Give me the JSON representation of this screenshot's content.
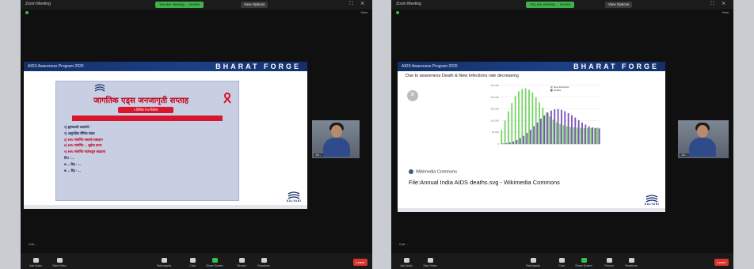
{
  "left": {
    "window_title": "Zoom Meeting",
    "share_banner": "You are viewing ... screen",
    "view_options": "View Options",
    "view_label": "View",
    "slide": {
      "program": "AIDS Awareness Program 2020",
      "brand": "BHARAT FORGE",
      "poster_title": "जागतिक एड्स जनजागृती सप्ताह",
      "poster_date": "१ डिसेंबर ते ७ डिसेंबर",
      "poster_lines": [
        "१) ह्यांच्याशी असलेले :",
        "२) असुरक्षित लैंगिक संबंध",
        "३) HIV संसर्गित रक्ताचे रक्तदान",
        "४) HIV संसर्गित ... सुईचा वापर",
        "५) HIV संसर्गित मातेकडून बाळाला",
        "टिप : ...",
        "■ ... केंद्र - ...",
        "■ ... केंद्र - ..."
      ],
      "logo_text": "KALYANI"
    },
    "participant_name": "Jul ...",
    "caption": "Coll ...",
    "toolbar": [
      {
        "label": "Join Audio",
        "icon": "headphones-icon"
      },
      {
        "label": "Start Video",
        "icon": "video-icon"
      },
      {
        "label": "Participants",
        "icon": "participants-icon"
      },
      {
        "label": "Chat",
        "icon": "chat-icon"
      },
      {
        "label": "Share Screen",
        "icon": "share-screen-icon"
      },
      {
        "label": "Record",
        "icon": "record-icon"
      },
      {
        "label": "Reactions",
        "icon": "reactions-icon"
      }
    ],
    "participants_count": "4",
    "leave_label": "Leave"
  },
  "right": {
    "window_title": "Zoom Meeting",
    "share_banner": "You are viewing ... screen",
    "view_options": "View Options",
    "view_label": "View",
    "slide": {
      "program": "AIDS Awareness Program 2020",
      "brand": "BHARAT FORGE",
      "chart_title": "Due to awareness Death & New Infections rate decreasing",
      "commons_label": "Wikimedia Commons",
      "file_label": "File:Annual India AIDS deaths.svg - Wikimedia Commons",
      "logo_text": "KALYANI"
    },
    "participant_name": "Jul ...",
    "caption": "Coll ...",
    "toolbar": [
      {
        "label": "Join Audio",
        "icon": "headphones-icon"
      },
      {
        "label": "Start Video",
        "icon": "video-icon"
      },
      {
        "label": "Participants",
        "icon": "participants-icon"
      },
      {
        "label": "Chat",
        "icon": "chat-icon"
      },
      {
        "label": "Share Screen",
        "icon": "share-screen-icon"
      },
      {
        "label": "Record",
        "icon": "record-icon"
      },
      {
        "label": "Reactions",
        "icon": "reactions-icon"
      }
    ],
    "participants_count": "4",
    "leave_label": "Leave"
  },
  "colors": {
    "banner_green": "#3fb24d",
    "leave_red": "#d9352b",
    "slide_header_navy": "#13306a",
    "new_infections": "#7ad36b",
    "deaths": "#7a52b8"
  },
  "chart_data": {
    "type": "bar",
    "title": "Due to awareness Death & New Infections rate decreasing",
    "xlabel": "",
    "ylabel": "",
    "ylim": [
      0,
      250000
    ],
    "x": [
      1990,
      1991,
      1992,
      1993,
      1994,
      1995,
      1996,
      1997,
      1998,
      1999,
      2000,
      2001,
      2002,
      2003,
      2004,
      2005,
      2006,
      2007,
      2008,
      2009,
      2010,
      2011,
      2012,
      2013,
      2014,
      2015,
      2016,
      2017,
      2018
    ],
    "series": [
      {
        "name": "New Infections",
        "color": "#7ad36b",
        "values": [
          60000,
          100000,
          140000,
          175000,
          205000,
          225000,
          235000,
          238000,
          232000,
          220000,
          200000,
          178000,
          155000,
          135000,
          118000,
          104000,
          93000,
          85000,
          80000,
          76000,
          73000,
          71000,
          70000,
          69000,
          68000,
          68000,
          68000,
          69000,
          70000
        ]
      },
      {
        "name": "Deaths",
        "color": "#7a52b8",
        "values": [
          2000,
          4000,
          7000,
          11000,
          17000,
          25000,
          35000,
          47000,
          61000,
          76000,
          92000,
          108000,
          122000,
          134000,
          143000,
          148000,
          149000,
          146000,
          140000,
          132000,
          123000,
          113000,
          102000,
          92000,
          83000,
          76000,
          71000,
          68000,
          66000
        ]
      }
    ]
  }
}
